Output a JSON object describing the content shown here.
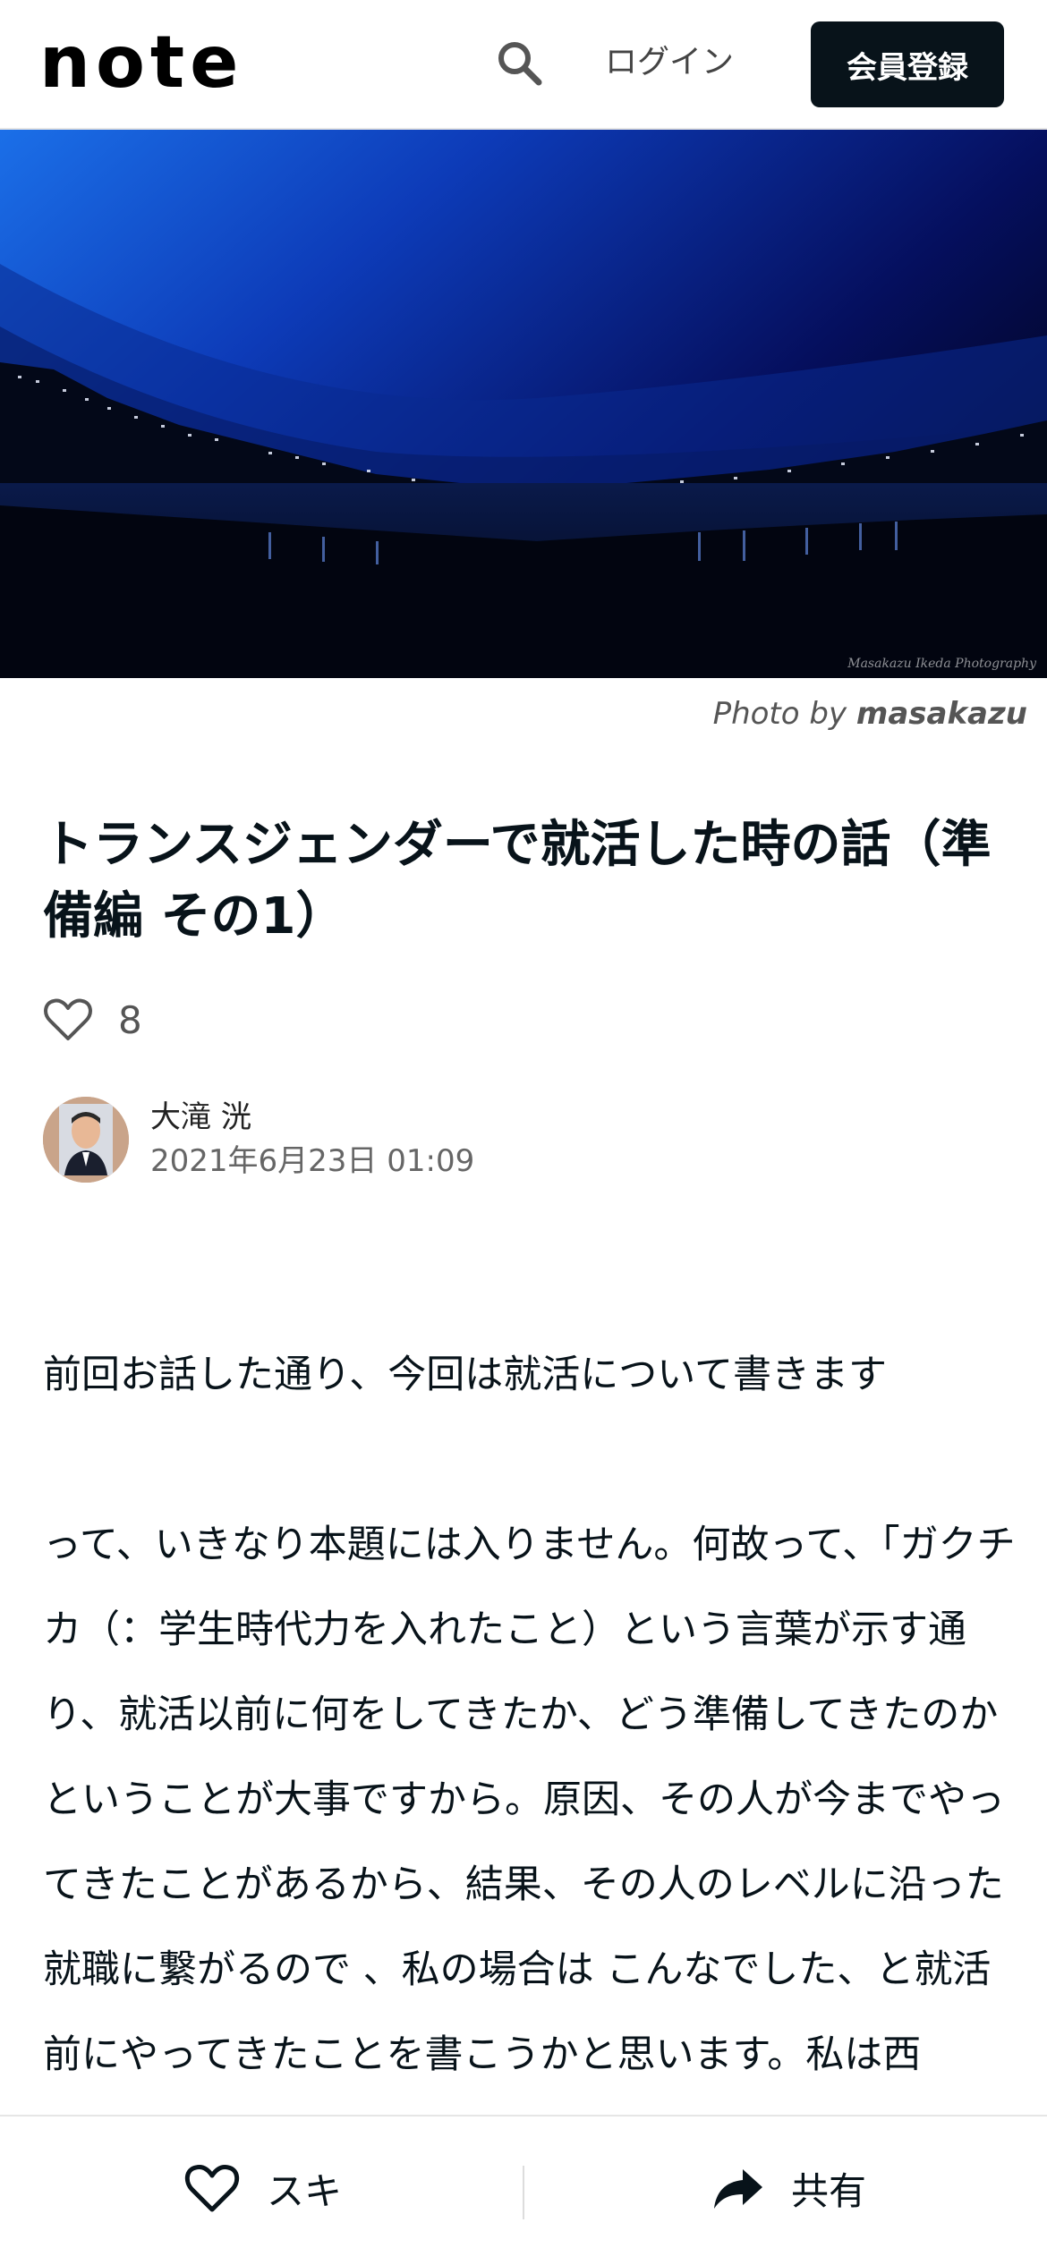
{
  "header": {
    "logo": "note",
    "login_label": "ログイン",
    "signup_label": "会員登録"
  },
  "hero": {
    "watermark": "Masakazu Ikeda Photography",
    "credit_prefix": "Photo by",
    "credit_name": "masakazu"
  },
  "article": {
    "title": "トランスジェンダーで就活した時の話（準備編 その1）",
    "like_count": "8",
    "author_name": "大滝 洸",
    "date": "2021年6月23日 01:09",
    "paragraph_1": "前回お話した通り、今回は就活について書きます",
    "paragraph_2": "って、いきなり本題には入りません。何故って、「ガクチカ（：学生時代力を入れたこと）という言葉が示す通り、就活以前に何をしてきたか、どう準備してきたのか ということが大事ですから。原因、その人が今までやってきたことがあるから、結果、その人のレベルに沿った就職に繋がるので 、私の場合は こんなでした、と就活前にやってきたことを書こうかと思います。私は西"
  },
  "bottom_bar": {
    "like_label": "スキ",
    "share_label": "共有"
  },
  "colors": {
    "brand_dark": "#08131a",
    "sky_blue": "#1c6fe0"
  }
}
